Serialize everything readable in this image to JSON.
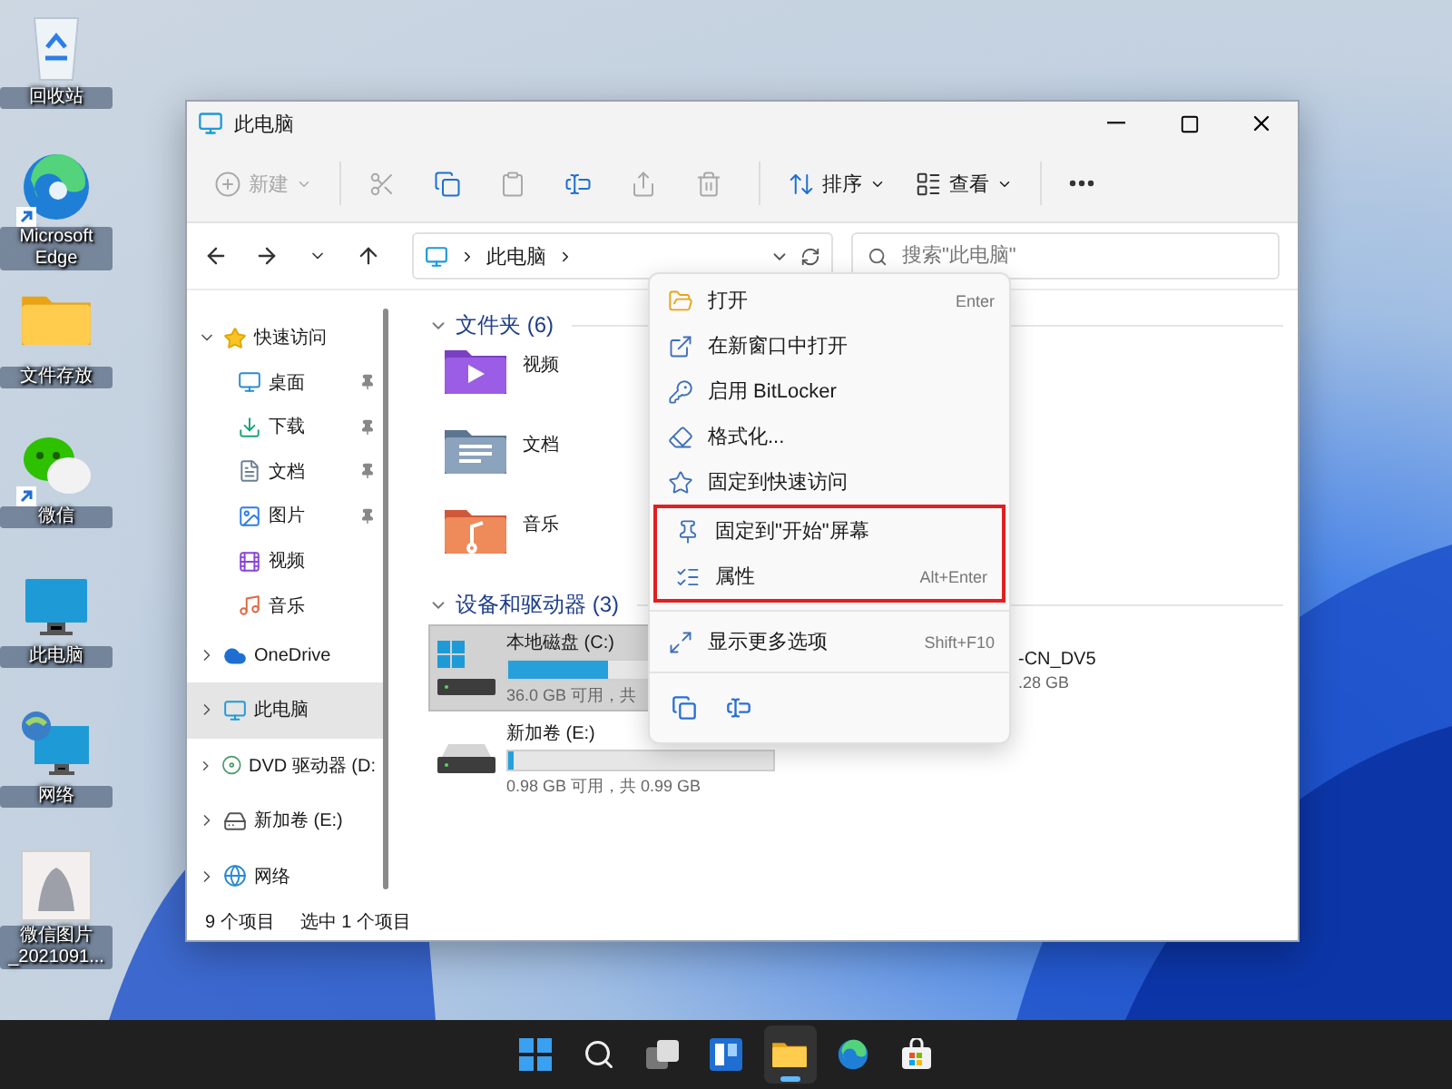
{
  "desktop_icons": [
    {
      "label": "回收站",
      "kind": "recycle",
      "shortcut": false
    },
    {
      "label": "Microsoft Edge",
      "kind": "edge",
      "shortcut": true
    },
    {
      "label": "文件存放",
      "kind": "folder",
      "shortcut": false
    },
    {
      "label": "微信",
      "kind": "chat",
      "shortcut": true
    },
    {
      "label": "此电脑",
      "kind": "pc",
      "shortcut": false
    },
    {
      "label": "网络",
      "kind": "network",
      "shortcut": false
    },
    {
      "label": "微信图片_2021091...",
      "kind": "image",
      "shortcut": false
    }
  ],
  "window": {
    "title": "此电脑",
    "toolbar": [
      {
        "kind": "new",
        "label": "新建",
        "disabled": true
      },
      {
        "kind": "cut",
        "disabled": true
      },
      {
        "kind": "copy",
        "disabled": false
      },
      {
        "kind": "paste",
        "disabled": true
      },
      {
        "kind": "rename",
        "disabled": false
      },
      {
        "kind": "share",
        "disabled": true
      },
      {
        "kind": "delete",
        "disabled": true
      },
      {
        "kind": "sort",
        "label": "排序",
        "disabled": false
      },
      {
        "kind": "view",
        "label": "查看",
        "disabled": false
      },
      {
        "kind": "more",
        "disabled": false
      }
    ],
    "address": {
      "path": "此电脑"
    },
    "search": {
      "placeholder": "搜索\"此电脑\""
    },
    "sidebar": [
      {
        "label": "快速访问",
        "kind": "star",
        "expanded": true,
        "selected": false,
        "children": [
          {
            "label": "桌面",
            "kind": "desktop",
            "pinned": true,
            "selected": false
          },
          {
            "label": "下载",
            "kind": "download",
            "pinned": true,
            "selected": false
          },
          {
            "label": "文档",
            "kind": "document",
            "pinned": true,
            "selected": false
          },
          {
            "label": "图片",
            "kind": "picture",
            "pinned": true,
            "selected": false
          },
          {
            "label": "视频",
            "kind": "video",
            "pinned": false,
            "selected": false
          },
          {
            "label": "音乐",
            "kind": "music",
            "pinned": false,
            "selected": false
          }
        ]
      },
      {
        "label": "OneDrive",
        "kind": "cloud",
        "expanded": false,
        "selected": false
      },
      {
        "label": "此电脑",
        "kind": "pc",
        "expanded": false,
        "selected": true
      },
      {
        "label": "DVD 驱动器 (D:",
        "kind": "dvd",
        "expanded": false,
        "selected": false
      },
      {
        "label": "新加卷 (E:)",
        "kind": "drive",
        "expanded": false,
        "selected": false
      },
      {
        "label": "网络",
        "kind": "network",
        "expanded": false,
        "selected": false
      }
    ],
    "folders_section": {
      "title": "文件夹 (6)",
      "expanded": true,
      "items": [
        {
          "label": "视频",
          "kind": "video"
        },
        {
          "label": "文档",
          "kind": "document"
        },
        {
          "label": "音乐",
          "kind": "music"
        }
      ]
    },
    "drives_section": {
      "title": "设备和驱动器 (3)",
      "expanded": true,
      "items": [
        {
          "label": "本地磁盘 (C:)",
          "kind": "system",
          "level": 0.375,
          "info": "36.0 GB 可用，共",
          "selected": true
        },
        {
          "label": "新加卷 (E:)",
          "kind": "drive",
          "level": 0.02,
          "info": "0.98 GB 可用，共 0.99 GB",
          "selected": false
        },
        {
          "label": "-CN_DV5",
          "kind": "partial",
          "info": ".28 GB"
        }
      ]
    },
    "status_bar": [
      "9 个项目",
      "选中 1 个项目"
    ]
  },
  "context_menu": {
    "items": [
      {
        "label": "打开",
        "kind": "open",
        "shortcut": "Enter",
        "highlighted": false
      },
      {
        "label": "在新窗口中打开",
        "kind": "new-window",
        "highlighted": false
      },
      {
        "label": "启用 BitLocker",
        "kind": "key",
        "highlighted": false
      },
      {
        "label": "格式化...",
        "kind": "format",
        "highlighted": false
      },
      {
        "label": "固定到快速访问",
        "kind": "star",
        "highlighted": false
      },
      {
        "label": "固定到\"开始\"屏幕",
        "kind": "pin",
        "highlighted": true
      },
      {
        "label": "属性",
        "kind": "properties",
        "shortcut": "Alt+Enter",
        "highlighted": true
      },
      {
        "label": "显示更多选项",
        "kind": "more",
        "shortcut": "Shift+F10",
        "highlighted": false,
        "separated": true
      }
    ],
    "actions": [
      {
        "kind": "copy"
      },
      {
        "kind": "rename"
      }
    ]
  },
  "taskbar": [
    {
      "kind": "start",
      "active": false
    },
    {
      "kind": "search",
      "active": false
    },
    {
      "kind": "task-view",
      "active": false
    },
    {
      "kind": "widgets",
      "active": false
    },
    {
      "kind": "explorer",
      "active": true
    },
    {
      "kind": "edge",
      "active": false
    },
    {
      "kind": "store",
      "active": false
    }
  ]
}
